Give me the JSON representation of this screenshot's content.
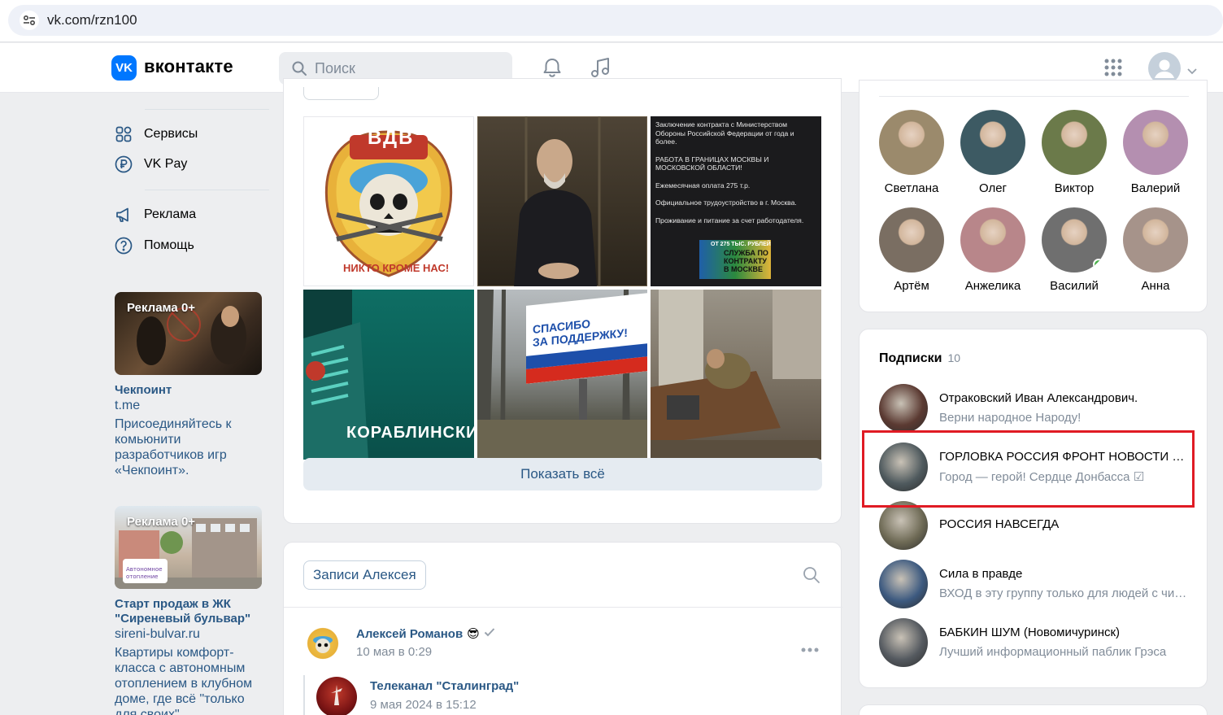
{
  "browser": {
    "url": "vk.com/rzn100"
  },
  "header": {
    "logo_mark": "VK",
    "logo_text": "вконтакте",
    "search_placeholder": "Поиск"
  },
  "left_nav": {
    "items": [
      "Сервисы",
      "VK Pay",
      "Реклама",
      "Помощь"
    ]
  },
  "ads": [
    {
      "badge": "Реклама 0+",
      "title": "Чекпоинт",
      "domain": "t.me",
      "desc": "Присоединяйтесь к комьюнити разработчиков игр «Чекпоинт»."
    },
    {
      "badge": "Реклама 0+",
      "title": "Старт продаж в ЖК \"Сиреневый бульвар\"",
      "domain": "sireni-bulvar.ru",
      "desc": "Квартиры комфорт-класса с автономным отоплением в клубном доме, где всё \"только для своих\""
    }
  ],
  "photos": {
    "vdv": {
      "top": "ВДВ",
      "bottom": "НИКТО КРОМЕ НАС!"
    },
    "contract_lines": [
      "Заключение контракта с Министерством Обороны Российской Федерации от года и более.",
      "РАБОТА В ГРАНИЦАХ МОСКВЫ И МОСКОВСКОЙ ОБЛАСТИ!",
      "Ежемесячная оплата 275 т.р.",
      "Официальное трудоустройство в г. Москва.",
      "Проживание и питание за счет работодателя."
    ],
    "contract_banner": [
      "ОТ 275 ТЫС. РУБЛЕЙ",
      "СЛУЖБА ПО КОНТРАКТУ В МОСКВЕ"
    ],
    "korablino": "КОРАБЛИНСКИ",
    "billboard": [
      "СПАСИБО",
      "ЗА ПОДДЕРЖКУ!"
    ],
    "show_all": "Показать всё"
  },
  "wall": {
    "tab": "Записи Алексея",
    "post": {
      "author": "Алексей Романов",
      "emoji": "😎",
      "time": "10 мая в 0:29"
    },
    "repost": {
      "author": "Телеканал \"Сталинград\"",
      "time": "9 мая 2024 в 15:12"
    }
  },
  "friends": [
    {
      "name": "Светлана",
      "color": "#9b8a6c"
    },
    {
      "name": "Олег",
      "color": "#3d5a63"
    },
    {
      "name": "Виктор",
      "color": "#6b7a4a"
    },
    {
      "name": "Валерий",
      "color": "#b48fb0"
    },
    {
      "name": "Артём",
      "color": "#7a6e62"
    },
    {
      "name": "Анжелика",
      "color": "#b8868a"
    },
    {
      "name": "Василий",
      "color": "#6f6f6f"
    },
    {
      "name": "Анна",
      "color": "#a6938a"
    }
  ],
  "subscriptions": {
    "title": "Подписки",
    "count": "10",
    "items": [
      {
        "name": "Отраковский Иван Александрович.",
        "desc": "Верни народное Народу!",
        "color": "#5b3a32"
      },
      {
        "name": "ГОРЛОВКА РОССИЯ ФРОНТ НОВОСТИ ДНР",
        "desc": "Город — герой! Сердце Донбасса ☑",
        "color": "#4f5a5e"
      },
      {
        "name": "РОССИЯ НАВСЕГДА",
        "desc": "",
        "color": "#6e6a55"
      },
      {
        "name": "Сила в правде",
        "desc": "ВХОД в эту группу только для людей с чистой совестью",
        "color": "#3d5a80"
      },
      {
        "name": "БАБКИН ШУМ (Новомичуринск)",
        "desc": "Лучший информационный паблик Грэса",
        "color": "#555a60"
      }
    ]
  },
  "highlight": {
    "color": "#e01b24",
    "target": "ГОРЛОВКА РОССИЯ ФРОНТ НОВОСТИ ДНР"
  }
}
